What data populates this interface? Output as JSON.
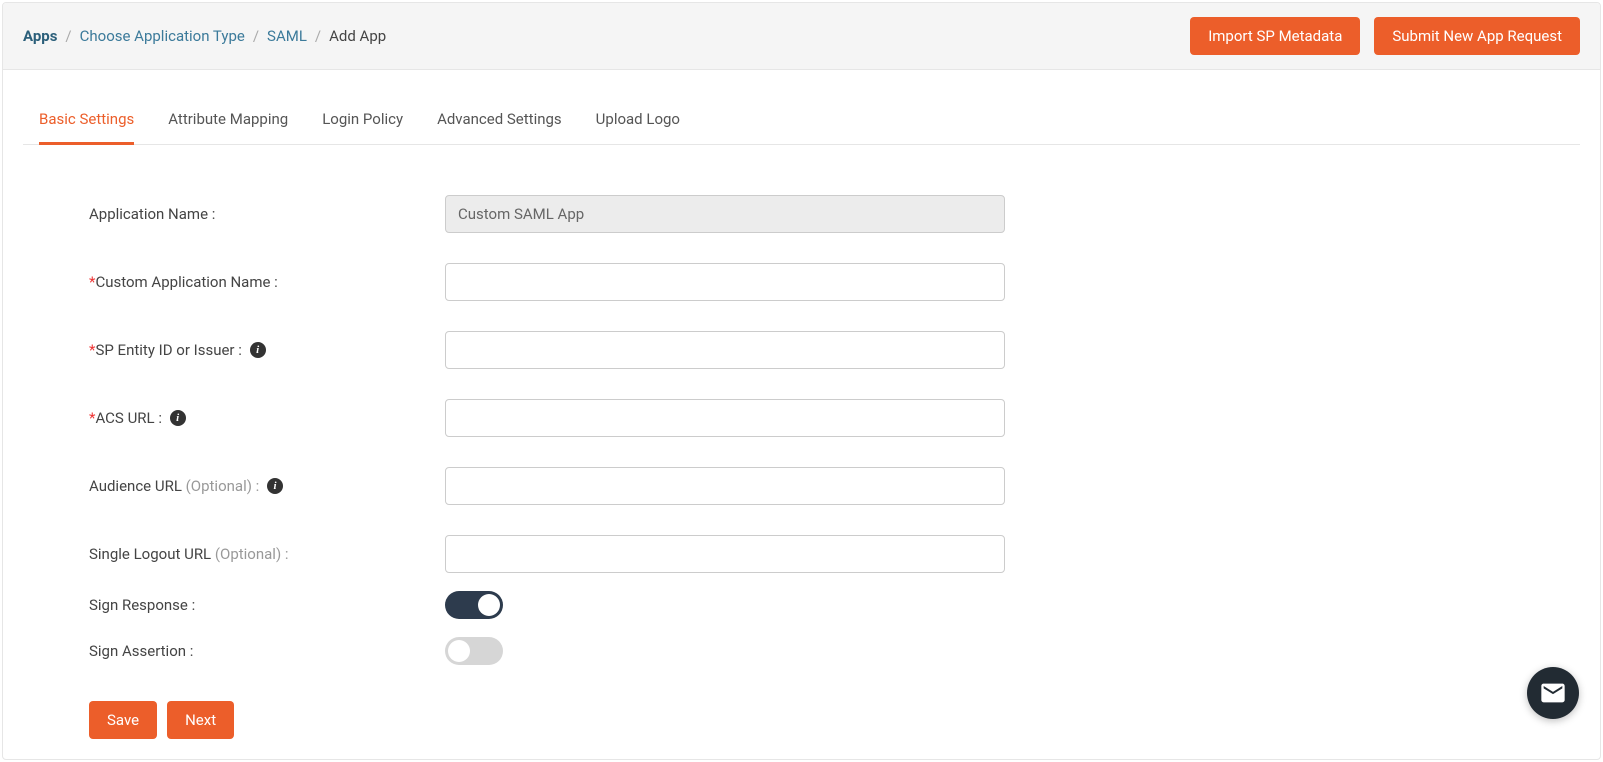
{
  "breadcrumb": {
    "items": [
      "Apps",
      "Choose Application Type",
      "SAML",
      "Add App"
    ]
  },
  "header": {
    "importButton": "Import SP Metadata",
    "submitButton": "Submit New App Request"
  },
  "tabs": [
    {
      "label": "Basic Settings",
      "active": true
    },
    {
      "label": "Attribute Mapping",
      "active": false
    },
    {
      "label": "Login Policy",
      "active": false
    },
    {
      "label": "Advanced Settings",
      "active": false
    },
    {
      "label": "Upload Logo",
      "active": false
    }
  ],
  "form": {
    "appName": {
      "label": "Application Name :",
      "value": "Custom SAML App"
    },
    "customAppName": {
      "label": "Custom Application Name :",
      "value": "",
      "required": true
    },
    "spEntityId": {
      "label": "SP Entity ID or Issuer :",
      "value": "",
      "required": true,
      "hasInfo": true
    },
    "acsUrl": {
      "label": "ACS URL :",
      "value": "",
      "required": true,
      "hasInfo": true
    },
    "audienceUrl": {
      "label": "Audience URL",
      "optional": "(Optional) :",
      "value": "",
      "hasInfo": true
    },
    "singleLogoutUrl": {
      "label": "Single Logout URL",
      "optional": "(Optional) :",
      "value": ""
    },
    "signResponse": {
      "label": "Sign Response :",
      "value": true
    },
    "signAssertion": {
      "label": "Sign Assertion :",
      "value": false
    }
  },
  "footer": {
    "save": "Save",
    "next": "Next"
  }
}
